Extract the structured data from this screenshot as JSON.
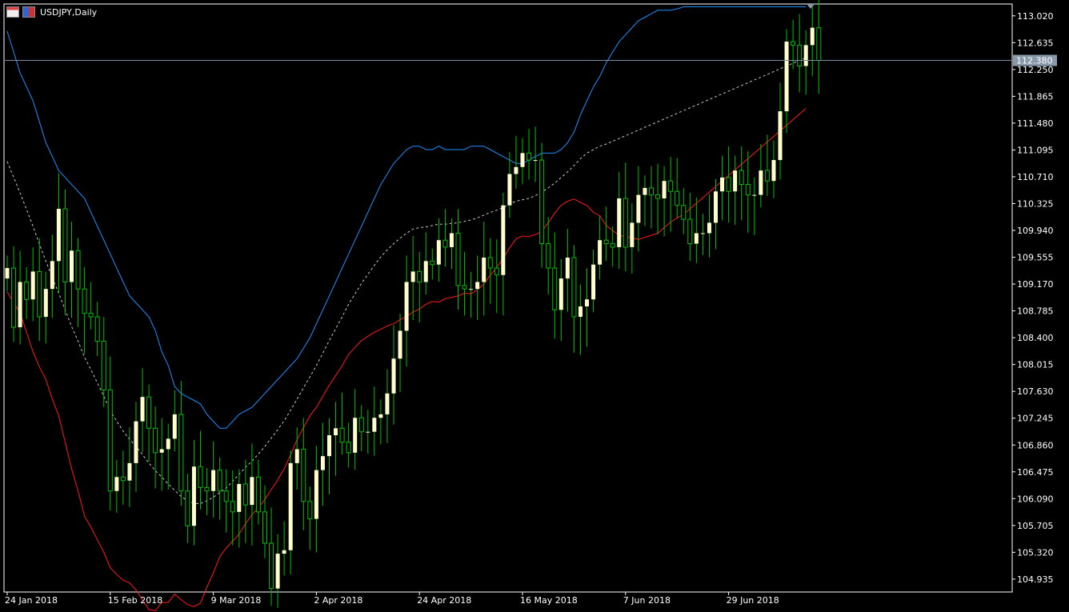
{
  "window": {
    "title": "USDJPY,Daily"
  },
  "icons": [
    "window-icon",
    "symbol-icon"
  ],
  "colors": {
    "background": "#000000",
    "frame": "#ffffff",
    "bull_candle": "#ffffcc",
    "wick": "#00c000",
    "upper_band": "#1e90ff",
    "middle_band": "#c8c8c8",
    "lower_band": "#ff1a1a",
    "price_line": "#7a8ba0",
    "price_label_bg": "#8899aa"
  },
  "price_label": "112.380",
  "chart_data": {
    "type": "candlestick",
    "y_ticks": [
      "113.020",
      "112.635",
      "112.250",
      "111.865",
      "111.480",
      "111.095",
      "110.710",
      "110.325",
      "109.940",
      "109.555",
      "109.170",
      "108.785",
      "108.400",
      "108.015",
      "107.630",
      "107.245",
      "106.860",
      "106.475",
      "106.090",
      "105.705",
      "105.320",
      "104.935"
    ],
    "x_ticks": [
      "24 Jan 2018",
      "15 Feb 2018",
      "9 Mar 2018",
      "2 Apr 2018",
      "24 Apr 2018",
      "16 May 2018",
      "7 Jun 2018",
      "29 Jun 2018"
    ],
    "ylim": [
      104.75,
      113.19
    ],
    "current_price": 112.38,
    "indicators": [
      "upper band",
      "middle band",
      "lower band"
    ],
    "close": [
      109.4,
      108.55,
      109.2,
      108.95,
      109.35,
      108.7,
      109.1,
      109.5,
      110.25,
      109.2,
      109.65,
      109.1,
      108.75,
      108.7,
      108.35,
      107.65,
      106.2,
      106.4,
      106.35,
      106.6,
      107.2,
      107.55,
      107.1,
      106.75,
      106.8,
      106.95,
      107.3,
      106.2,
      105.7,
      106.55,
      106.25,
      106.2,
      106.5,
      106.2,
      106.05,
      105.9,
      106.3,
      106.0,
      106.4,
      105.9,
      105.45,
      104.8,
      105.3,
      105.35,
      106.6,
      106.8,
      106.05,
      105.8,
      106.5,
      106.7,
      107.0,
      107.1,
      106.9,
      106.75,
      107.25,
      107.05,
      107.05,
      107.25,
      107.3,
      107.6,
      108.1,
      108.5,
      109.2,
      109.35,
      109.2,
      109.5,
      109.45,
      109.8,
      109.7,
      109.9,
      109.15,
      109.1,
      109.1,
      109.2,
      109.55,
      109.4,
      109.3,
      110.3,
      110.75,
      110.85,
      111.05,
      110.95,
      110.95,
      109.75,
      109.4,
      108.8,
      109.25,
      109.55,
      108.7,
      108.85,
      108.95,
      109.45,
      109.8,
      109.75,
      109.7,
      110.4,
      109.7,
      110.05,
      110.45,
      110.55,
      110.45,
      110.4,
      110.65,
      110.5,
      110.3,
      110.1,
      109.75,
      109.9,
      109.9,
      110.05,
      110.5,
      110.7,
      110.5,
      110.8,
      110.6,
      110.45,
      110.45,
      110.8,
      110.65,
      110.95,
      111.65,
      112.65,
      112.6,
      112.3,
      112.6,
      112.85,
      112.38
    ],
    "upper": [
      112.8,
      112.5,
      112.2,
      112.0,
      111.8,
      111.5,
      111.2,
      111.0,
      110.8,
      110.7,
      110.6,
      110.5,
      110.4,
      110.2,
      110.0,
      109.8,
      109.6,
      109.4,
      109.2,
      109.0,
      108.9,
      108.8,
      108.7,
      108.5,
      108.2,
      108.0,
      107.7,
      107.6,
      107.55,
      107.5,
      107.45,
      107.3,
      107.2,
      107.1,
      107.1,
      107.2,
      107.3,
      107.35,
      107.4,
      107.5,
      107.6,
      107.7,
      107.8,
      107.9,
      108.0,
      108.1,
      108.25,
      108.4,
      108.6,
      108.8,
      109.0,
      109.2,
      109.4,
      109.6,
      109.8,
      110.0,
      110.2,
      110.4,
      110.6,
      110.75,
      110.9,
      111.0,
      111.1,
      111.15,
      111.15,
      111.1,
      111.1,
      111.15,
      111.1,
      111.1,
      111.1,
      111.1,
      111.15,
      111.15,
      111.15,
      111.1,
      111.05,
      111.0,
      110.95,
      110.9,
      110.9,
      110.95,
      111.0,
      111.05,
      111.05,
      111.05,
      111.1,
      111.2,
      111.35,
      111.6,
      111.8,
      112.0,
      112.15,
      112.35,
      112.5,
      112.65,
      112.75,
      112.85,
      112.95,
      113.0,
      113.05,
      113.1,
      113.1,
      113.1,
      113.12,
      113.15,
      113.15,
      113.15,
      113.15,
      113.15,
      113.15,
      113.15,
      113.15,
      113.15,
      113.15,
      113.15,
      113.15,
      113.15,
      113.15,
      113.15,
      113.15,
      113.15,
      113.15,
      113.15,
      113.15
    ],
    "middle": [
      110.93,
      110.7,
      110.48,
      110.24,
      110.0,
      109.74,
      109.5,
      109.26,
      109.04,
      108.8,
      108.56,
      108.35,
      108.12,
      107.94,
      107.75,
      107.56,
      107.35,
      107.2,
      107.06,
      106.94,
      106.84,
      106.72,
      106.6,
      106.49,
      106.4,
      106.3,
      106.21,
      106.12,
      106.06,
      106.02,
      106.02,
      106.06,
      106.11,
      106.18,
      106.24,
      106.34,
      106.44,
      106.54,
      106.63,
      106.73,
      106.84,
      106.96,
      107.08,
      107.21,
      107.36,
      107.52,
      107.68,
      107.84,
      108.0,
      108.18,
      108.36,
      108.53,
      108.7,
      108.88,
      109.03,
      109.18,
      109.31,
      109.44,
      109.56,
      109.66,
      109.75,
      109.83,
      109.9,
      109.96,
      109.98,
      109.99,
      110.01,
      110.03,
      110.03,
      110.04,
      110.05,
      110.07,
      110.09,
      110.12,
      110.16,
      110.2,
      110.23,
      110.27,
      110.32,
      110.36,
      110.38,
      110.4,
      110.44,
      110.49,
      110.55,
      110.62,
      110.7,
      110.78,
      110.87,
      110.97,
      111.05,
      111.1,
      111.15,
      111.18,
      111.22,
      111.26,
      111.3,
      111.34,
      111.38,
      111.42,
      111.46,
      111.5,
      111.54,
      111.58,
      111.62,
      111.66,
      111.7,
      111.74,
      111.78,
      111.82,
      111.86,
      111.9,
      111.94,
      111.98,
      112.02,
      112.06,
      112.1,
      112.14,
      112.18,
      112.22,
      112.26,
      112.3,
      112.34,
      112.38,
      112.42
    ]
  }
}
